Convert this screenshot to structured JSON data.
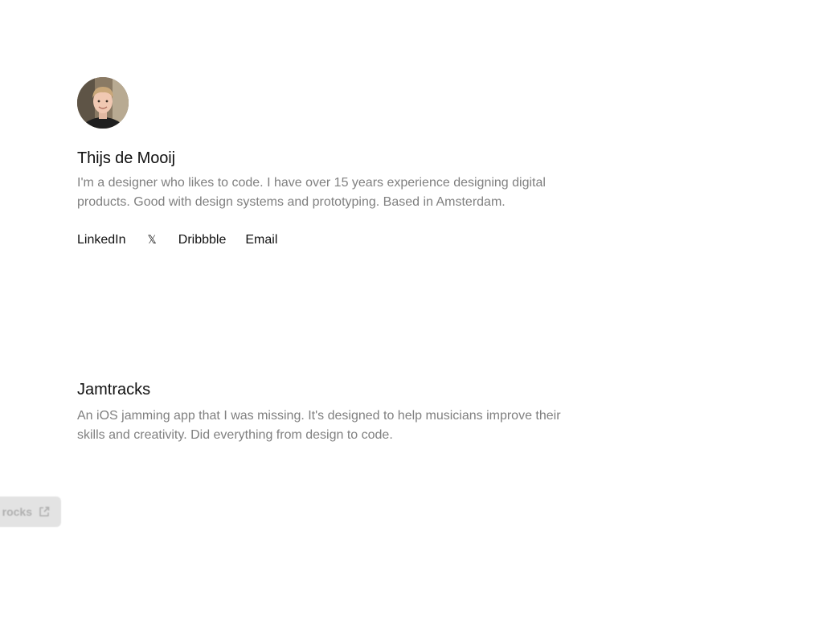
{
  "profile": {
    "avatar_icon": "avatar-photo",
    "name": "Thijs de Mooij",
    "bio": "I'm a designer who likes to code. I have over 15 years experience designing digital products. Good with design systems and prototyping. Based in Amsterdam."
  },
  "social": {
    "linkedin": "LinkedIn",
    "x": "𝕏",
    "dribbble": "Dribbble",
    "email": "Email"
  },
  "project": {
    "title": "Jamtracks",
    "description": "An iOS jamming app that I was missing. It's designed to help musicians improve their skills and creativity. Did everything from design to code."
  },
  "floating_button": {
    "label": "rocks",
    "icon": "external-link-icon"
  },
  "colors": {
    "text_primary": "#111111",
    "text_secondary": "#808080",
    "button_bg": "#e3e3e3"
  }
}
